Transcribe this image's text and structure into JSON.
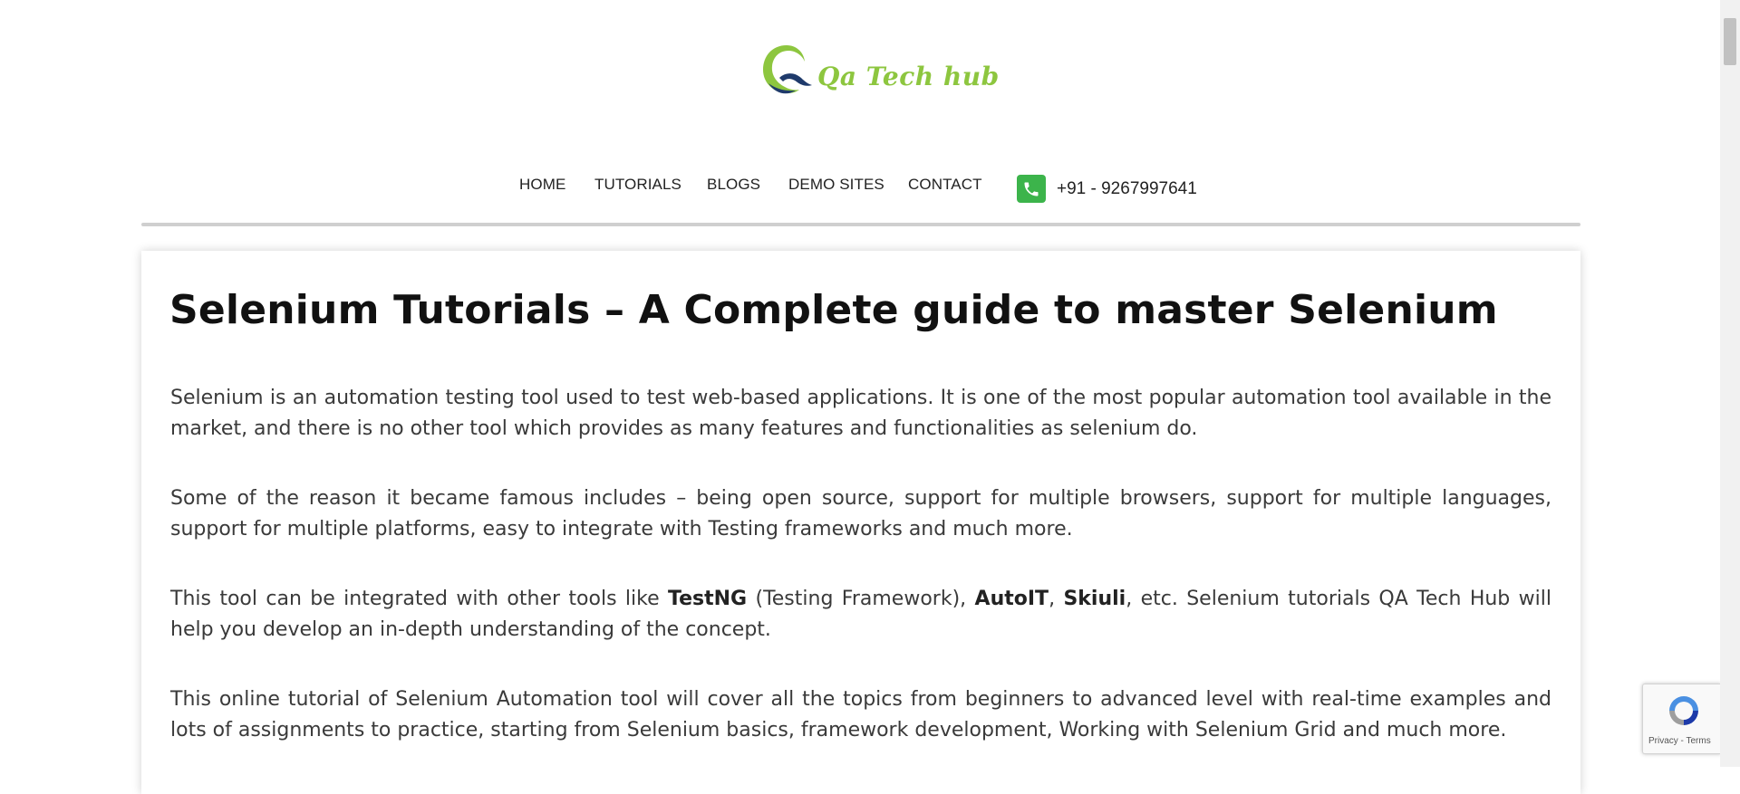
{
  "header": {
    "logo_text": "Qa Tech hub",
    "brand_colors": {
      "green": "#8dc63f",
      "navy": "#1f3a6b"
    }
  },
  "nav": {
    "items": [
      {
        "label": "HOME"
      },
      {
        "label": "TUTORIALS"
      },
      {
        "label": "BLOGS"
      },
      {
        "label": "DEMO SITES"
      },
      {
        "label": "CONTACT"
      }
    ],
    "phone": {
      "icon": "phone-icon",
      "number": "+91 - 9267997641",
      "badge_color": "#3cb44b"
    }
  },
  "main": {
    "title": "Selenium Tutorials – A Complete guide to master Selenium",
    "paragraphs": {
      "p1": "Selenium is an automation testing tool used to test web-based applications. It is one of the most popular automation tool available in the market, and there is no other tool which provides as many features and functionalities as selenium do.",
      "p2": "Some of the reason it became famous includes – being open source, support for multiple browsers, support for multiple languages, support for multiple platforms, easy to integrate with Testing frameworks and much more.",
      "p3": {
        "t1": "This tool can be integrated with other tools like ",
        "b1": "TestNG",
        "t2": " (Testing Framework), ",
        "b2": "AutoIT",
        "t3": ", ",
        "b3": "Skiuli",
        "t4": ", etc. Selenium tutorials QA Tech Hub will help you develop an in-depth understanding of the concept."
      },
      "p4": "This online tutorial of Selenium Automation tool will cover all the topics from beginners to advanced level with real-time examples and lots of assignments to practice, starting from Selenium basics, framework development, Working with Selenium Grid and much more."
    }
  },
  "recaptcha": {
    "links": "Privacy - Terms",
    "icon": "recaptcha-icon"
  }
}
